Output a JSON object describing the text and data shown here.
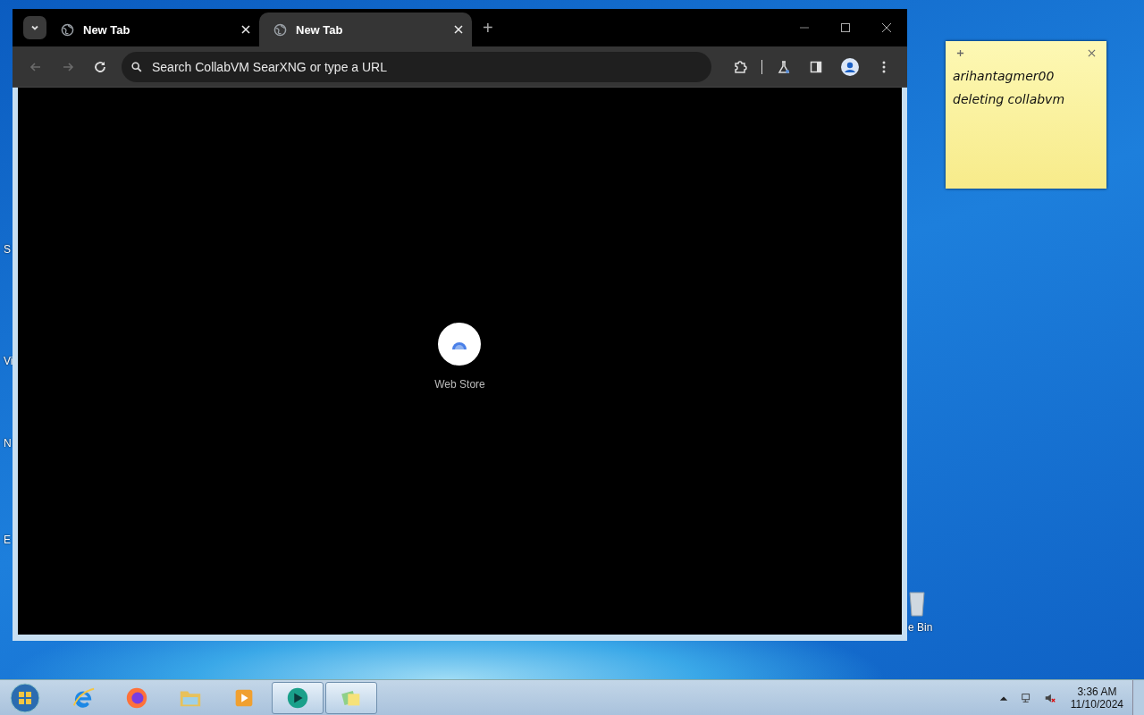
{
  "desktop_icons": [
    {
      "label": "S"
    },
    {
      "label": "Vi"
    },
    {
      "label": "N"
    },
    {
      "label": "E"
    }
  ],
  "recycle_bin": {
    "label": "e Bin"
  },
  "browser": {
    "tabs": [
      {
        "title": "New Tab",
        "selected": false
      },
      {
        "title": "New Tab",
        "selected": true
      }
    ],
    "new_tab": "+",
    "omnibox": {
      "placeholder": "Search CollabVM SearXNG or type a URL"
    },
    "shortcut": {
      "label": "Web Store"
    }
  },
  "sticky_note": {
    "lines": [
      "arihantagmer00",
      "deleting collabvm"
    ]
  },
  "taskbar": {
    "apps": [
      {
        "kind": "ie",
        "active": false
      },
      {
        "kind": "firefox",
        "active": false
      },
      {
        "kind": "folder",
        "active": false
      },
      {
        "kind": "media",
        "active": false
      },
      {
        "kind": "vm",
        "active": true
      },
      {
        "kind": "notes",
        "active": true
      }
    ],
    "time": "3:36 AM",
    "date": "11/10/2024"
  }
}
